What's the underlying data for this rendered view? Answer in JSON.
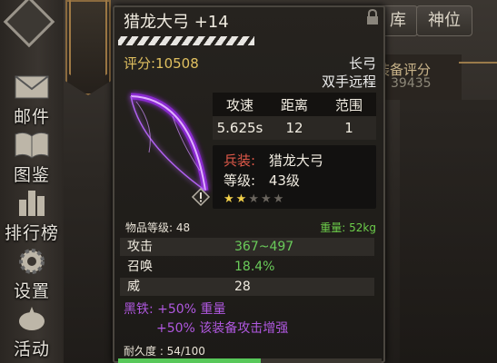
{
  "sidebar": {
    "items": [
      {
        "label": "邮件",
        "icon": "mail-icon"
      },
      {
        "label": "图鉴",
        "icon": "book-icon"
      },
      {
        "label": "排行榜",
        "icon": "ranking-icon"
      },
      {
        "label": "设置",
        "icon": "gear-icon"
      },
      {
        "label": "活动",
        "icon": "event-icon"
      }
    ]
  },
  "tabs": [
    {
      "label": "库"
    },
    {
      "label": "神位"
    }
  ],
  "right_panel": {
    "score_label": "装备评分",
    "score_value": "39435"
  },
  "item": {
    "name": "猎龙大弓 +14",
    "score": "评分:10508",
    "weapon_type": "长弓",
    "hand_type": "双手远程",
    "stats_headers": [
      "攻速",
      "距离",
      "范围"
    ],
    "stats_values": [
      "5.625s",
      "12",
      "1"
    ],
    "equip_label": "兵装:",
    "equip_value": "猎龙大弓",
    "level_label": "等级:",
    "level_value": "43级",
    "stars_filled": 2,
    "stars_total": 5,
    "item_level": "物品等级: 48",
    "weight": "重量: 52kg",
    "attributes": [
      {
        "key": "攻击",
        "value": "367~497",
        "color": "green"
      },
      {
        "key": "召唤",
        "value": "18.4%",
        "color": "green"
      },
      {
        "key": "威",
        "value": "28",
        "color": "white"
      }
    ],
    "bonus_line1": "黑铁: +50% 重量",
    "bonus_line2": "+50% 该装备攻击增强",
    "durability": "耐久度 : 54/100",
    "durability_fraction": 0.54
  },
  "colors": {
    "score": "#e0c060",
    "green": "#6acb5a",
    "purple": "#b058e0",
    "red_label": "#e25a4a",
    "star": "#f2d04a"
  }
}
